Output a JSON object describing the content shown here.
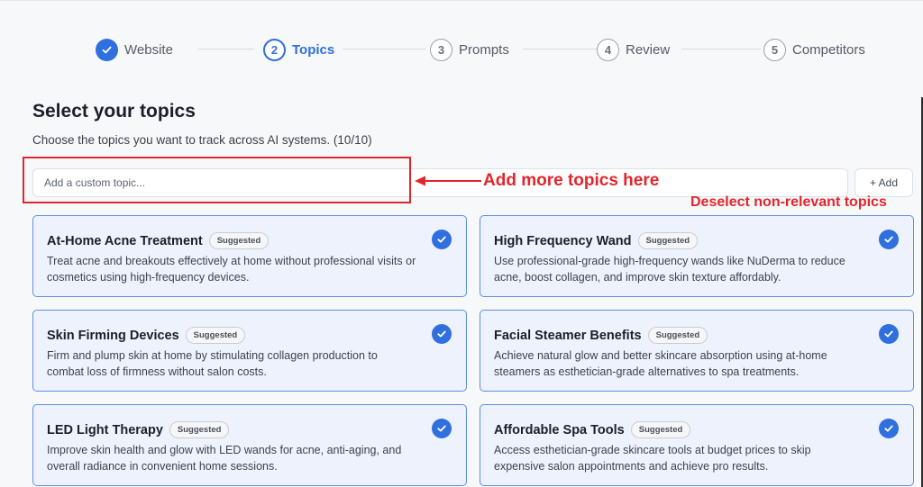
{
  "stepper": {
    "steps": [
      {
        "number": "1",
        "label": "Website",
        "state": "done"
      },
      {
        "number": "2",
        "label": "Topics",
        "state": "active"
      },
      {
        "number": "3",
        "label": "Prompts",
        "state": "todo"
      },
      {
        "number": "4",
        "label": "Review",
        "state": "todo"
      },
      {
        "number": "5",
        "label": "Competitors",
        "state": "todo"
      }
    ]
  },
  "page": {
    "title": "Select your topics",
    "subtitle": "Choose the topics you want to track across AI systems. (10/10)"
  },
  "custom_topic": {
    "placeholder": "Add a custom topic...",
    "value": "",
    "add_label": "+ Add"
  },
  "annotations": {
    "add_more": "Add more topics here",
    "deselect": "Deselect non-relevant topics"
  },
  "topics": [
    {
      "title": "At-Home Acne Treatment",
      "badge": "Suggested",
      "description": "Treat acne and breakouts effectively at home without professional visits or cosmetics using high-frequency devices.",
      "selected": true
    },
    {
      "title": "High Frequency Wand",
      "badge": "Suggested",
      "description": "Use professional-grade high-frequency wands like NuDerma to reduce acne, boost collagen, and improve skin texture affordably.",
      "selected": true
    },
    {
      "title": "Skin Firming Devices",
      "badge": "Suggested",
      "description": "Firm and plump skin at home by stimulating collagen production to combat loss of firmness without salon costs.",
      "selected": true
    },
    {
      "title": "Facial Steamer Benefits",
      "badge": "Suggested",
      "description": "Achieve natural glow and better skincare absorption using at-home steamers as esthetician-grade alternatives to spa treatments.",
      "selected": true
    },
    {
      "title": "LED Light Therapy",
      "badge": "Suggested",
      "description": "Improve skin health and glow with LED wands for acne, anti-aging, and overall radiance in convenient home sessions.",
      "selected": true
    },
    {
      "title": "Affordable Spa Tools",
      "badge": "Suggested",
      "description": "Access esthetician-grade skincare tools at budget prices to skip expensive salon appointments and achieve pro results.",
      "selected": true
    }
  ],
  "colors": {
    "accent": "#2f6fde",
    "annotation": "#e0262d",
    "card_bg": "#edf2fd",
    "card_border": "#5b8fe6"
  },
  "icons": {
    "done_step": "check-icon",
    "selected_card": "check-circle-icon"
  }
}
